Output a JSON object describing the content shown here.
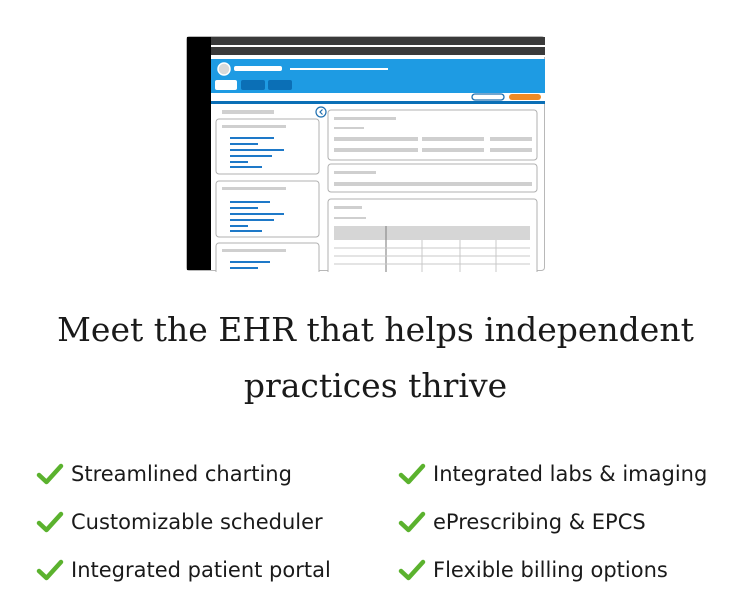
{
  "headline": {
    "line1": "Meet the EHR that helps independent",
    "line2": "practices thrive"
  },
  "features": [
    "Streamlined charting",
    "Integrated labs & imaging",
    "Customizable scheduler",
    "ePrescribing & EPCS",
    "Integrated patient portal",
    "Flexible billing options"
  ],
  "colors": {
    "check": "#5bb22e",
    "app_blue": "#1e9be3",
    "tab_blue": "#0b6fb6",
    "accent_orange": "#f08a24",
    "frame_dark": "#000000"
  },
  "icons": {
    "check": "check-icon",
    "collapse": "chevron-left-icon",
    "avatar": "avatar-icon"
  }
}
